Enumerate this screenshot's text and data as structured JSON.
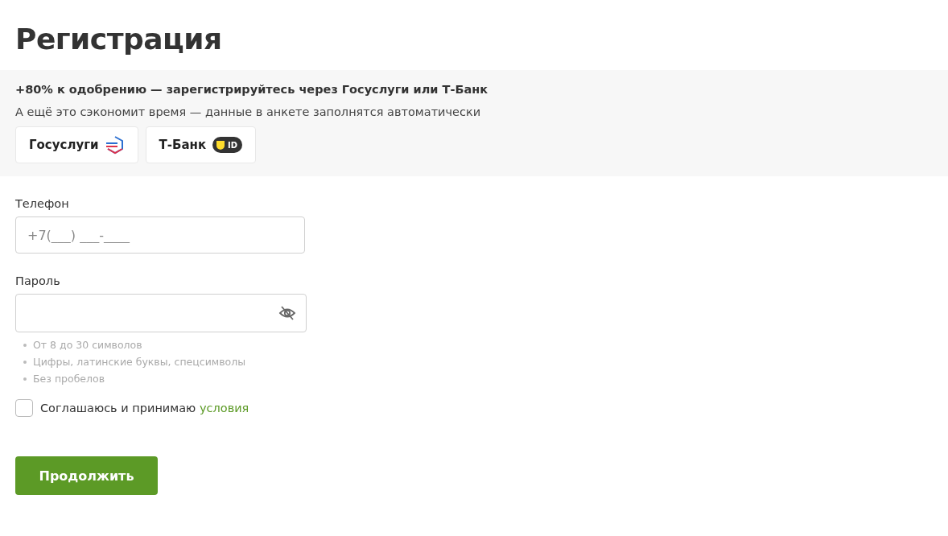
{
  "title": "Регистрация",
  "promo": {
    "headline": "+80% к одобрению — зарегистрируйтесь через Госуслуги или Т-Банк",
    "subtitle": "А ещё это сэкономит время — данные в анкете заполнятся автоматически",
    "providers": [
      {
        "kind": "gosuslugi",
        "label": "Госуслуги"
      },
      {
        "kind": "tbank",
        "label": "Т-Банк",
        "badge": "ID"
      }
    ]
  },
  "fields": [
    {
      "kind": "phone",
      "label": "Телефон",
      "placeholder": "+7(___) ___-____"
    },
    {
      "kind": "password",
      "label": "Пароль",
      "hints": [
        "От 8 до 30 символов",
        "Цифры, латинские буквы, спецсимволы",
        "Без пробелов"
      ]
    }
  ],
  "agreement": {
    "text": "Соглашаюсь и принимаю",
    "link": "условия",
    "checked": false
  },
  "submit": "Продолжить"
}
